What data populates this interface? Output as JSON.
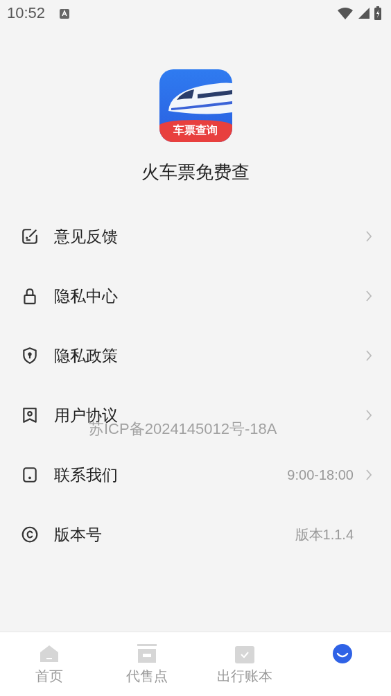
{
  "status_bar": {
    "time": "10:52"
  },
  "app": {
    "logo_text": "车票查询",
    "name": "火车票免费查"
  },
  "menu": [
    {
      "label": "意见反馈",
      "arrow": true
    },
    {
      "label": "隐私中心",
      "arrow": true
    },
    {
      "label": "隐私政策",
      "arrow": true
    },
    {
      "label": "用户协议",
      "arrow": true
    },
    {
      "label": "联系我们",
      "value": "9:00-18:00",
      "arrow": true
    },
    {
      "label": "版本号",
      "value": "版本1.1.4",
      "arrow": false
    }
  ],
  "overlay_text": "苏ICP备2024145012号-18A",
  "tabs": [
    {
      "label": "首页",
      "selected": false
    },
    {
      "label": "代售点",
      "selected": false
    },
    {
      "label": "出行账本",
      "selected": false
    },
    {
      "selected": true
    }
  ]
}
